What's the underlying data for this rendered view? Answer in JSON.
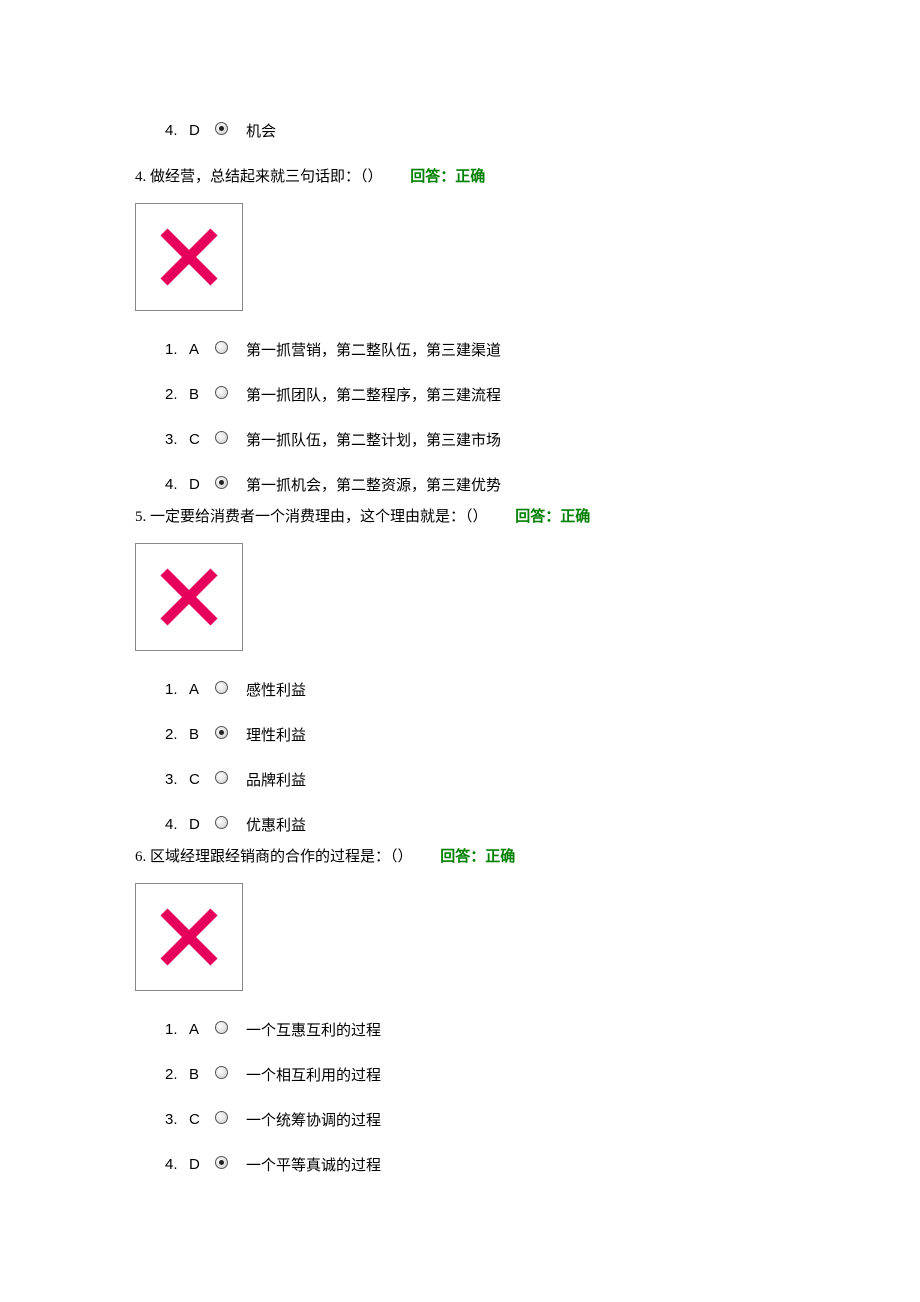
{
  "colors": {
    "feedback": "#008000",
    "cross": "#E6005C"
  },
  "leading_option": {
    "num": "4.",
    "letter": "D",
    "selected": true,
    "text": "机会"
  },
  "questions": [
    {
      "number": "4.",
      "text": "做经营，总结起来就三句话即：（）",
      "feedback": "回答：正确",
      "options": [
        {
          "num": "1.",
          "letter": "A",
          "selected": false,
          "text": "第一抓营销，第二整队伍，第三建渠道"
        },
        {
          "num": "2.",
          "letter": "B",
          "selected": false,
          "text": "第一抓团队，第二整程序，第三建流程"
        },
        {
          "num": "3.",
          "letter": "C",
          "selected": false,
          "text": "第一抓队伍，第二整计划，第三建市场"
        },
        {
          "num": "4.",
          "letter": "D",
          "selected": true,
          "text": "第一抓机会，第二整资源，第三建优势"
        }
      ]
    },
    {
      "number": "5.",
      "text": "一定要给消费者一个消费理由，这个理由就是：（）",
      "feedback": "回答：正确",
      "options": [
        {
          "num": "1.",
          "letter": "A",
          "selected": false,
          "text": "感性利益"
        },
        {
          "num": "2.",
          "letter": "B",
          "selected": true,
          "text": "理性利益"
        },
        {
          "num": "3.",
          "letter": "C",
          "selected": false,
          "text": "品牌利益"
        },
        {
          "num": "4.",
          "letter": "D",
          "selected": false,
          "text": "优惠利益"
        }
      ]
    },
    {
      "number": "6.",
      "text": "区域经理跟经销商的合作的过程是：（）",
      "feedback": "回答：正确",
      "options": [
        {
          "num": "1.",
          "letter": "A",
          "selected": false,
          "text": "一个互惠互利的过程"
        },
        {
          "num": "2.",
          "letter": "B",
          "selected": false,
          "text": "一个相互利用的过程"
        },
        {
          "num": "3.",
          "letter": "C",
          "selected": false,
          "text": "一个统筹协调的过程"
        },
        {
          "num": "4.",
          "letter": "D",
          "selected": true,
          "text": "一个平等真诚的过程"
        }
      ]
    }
  ]
}
